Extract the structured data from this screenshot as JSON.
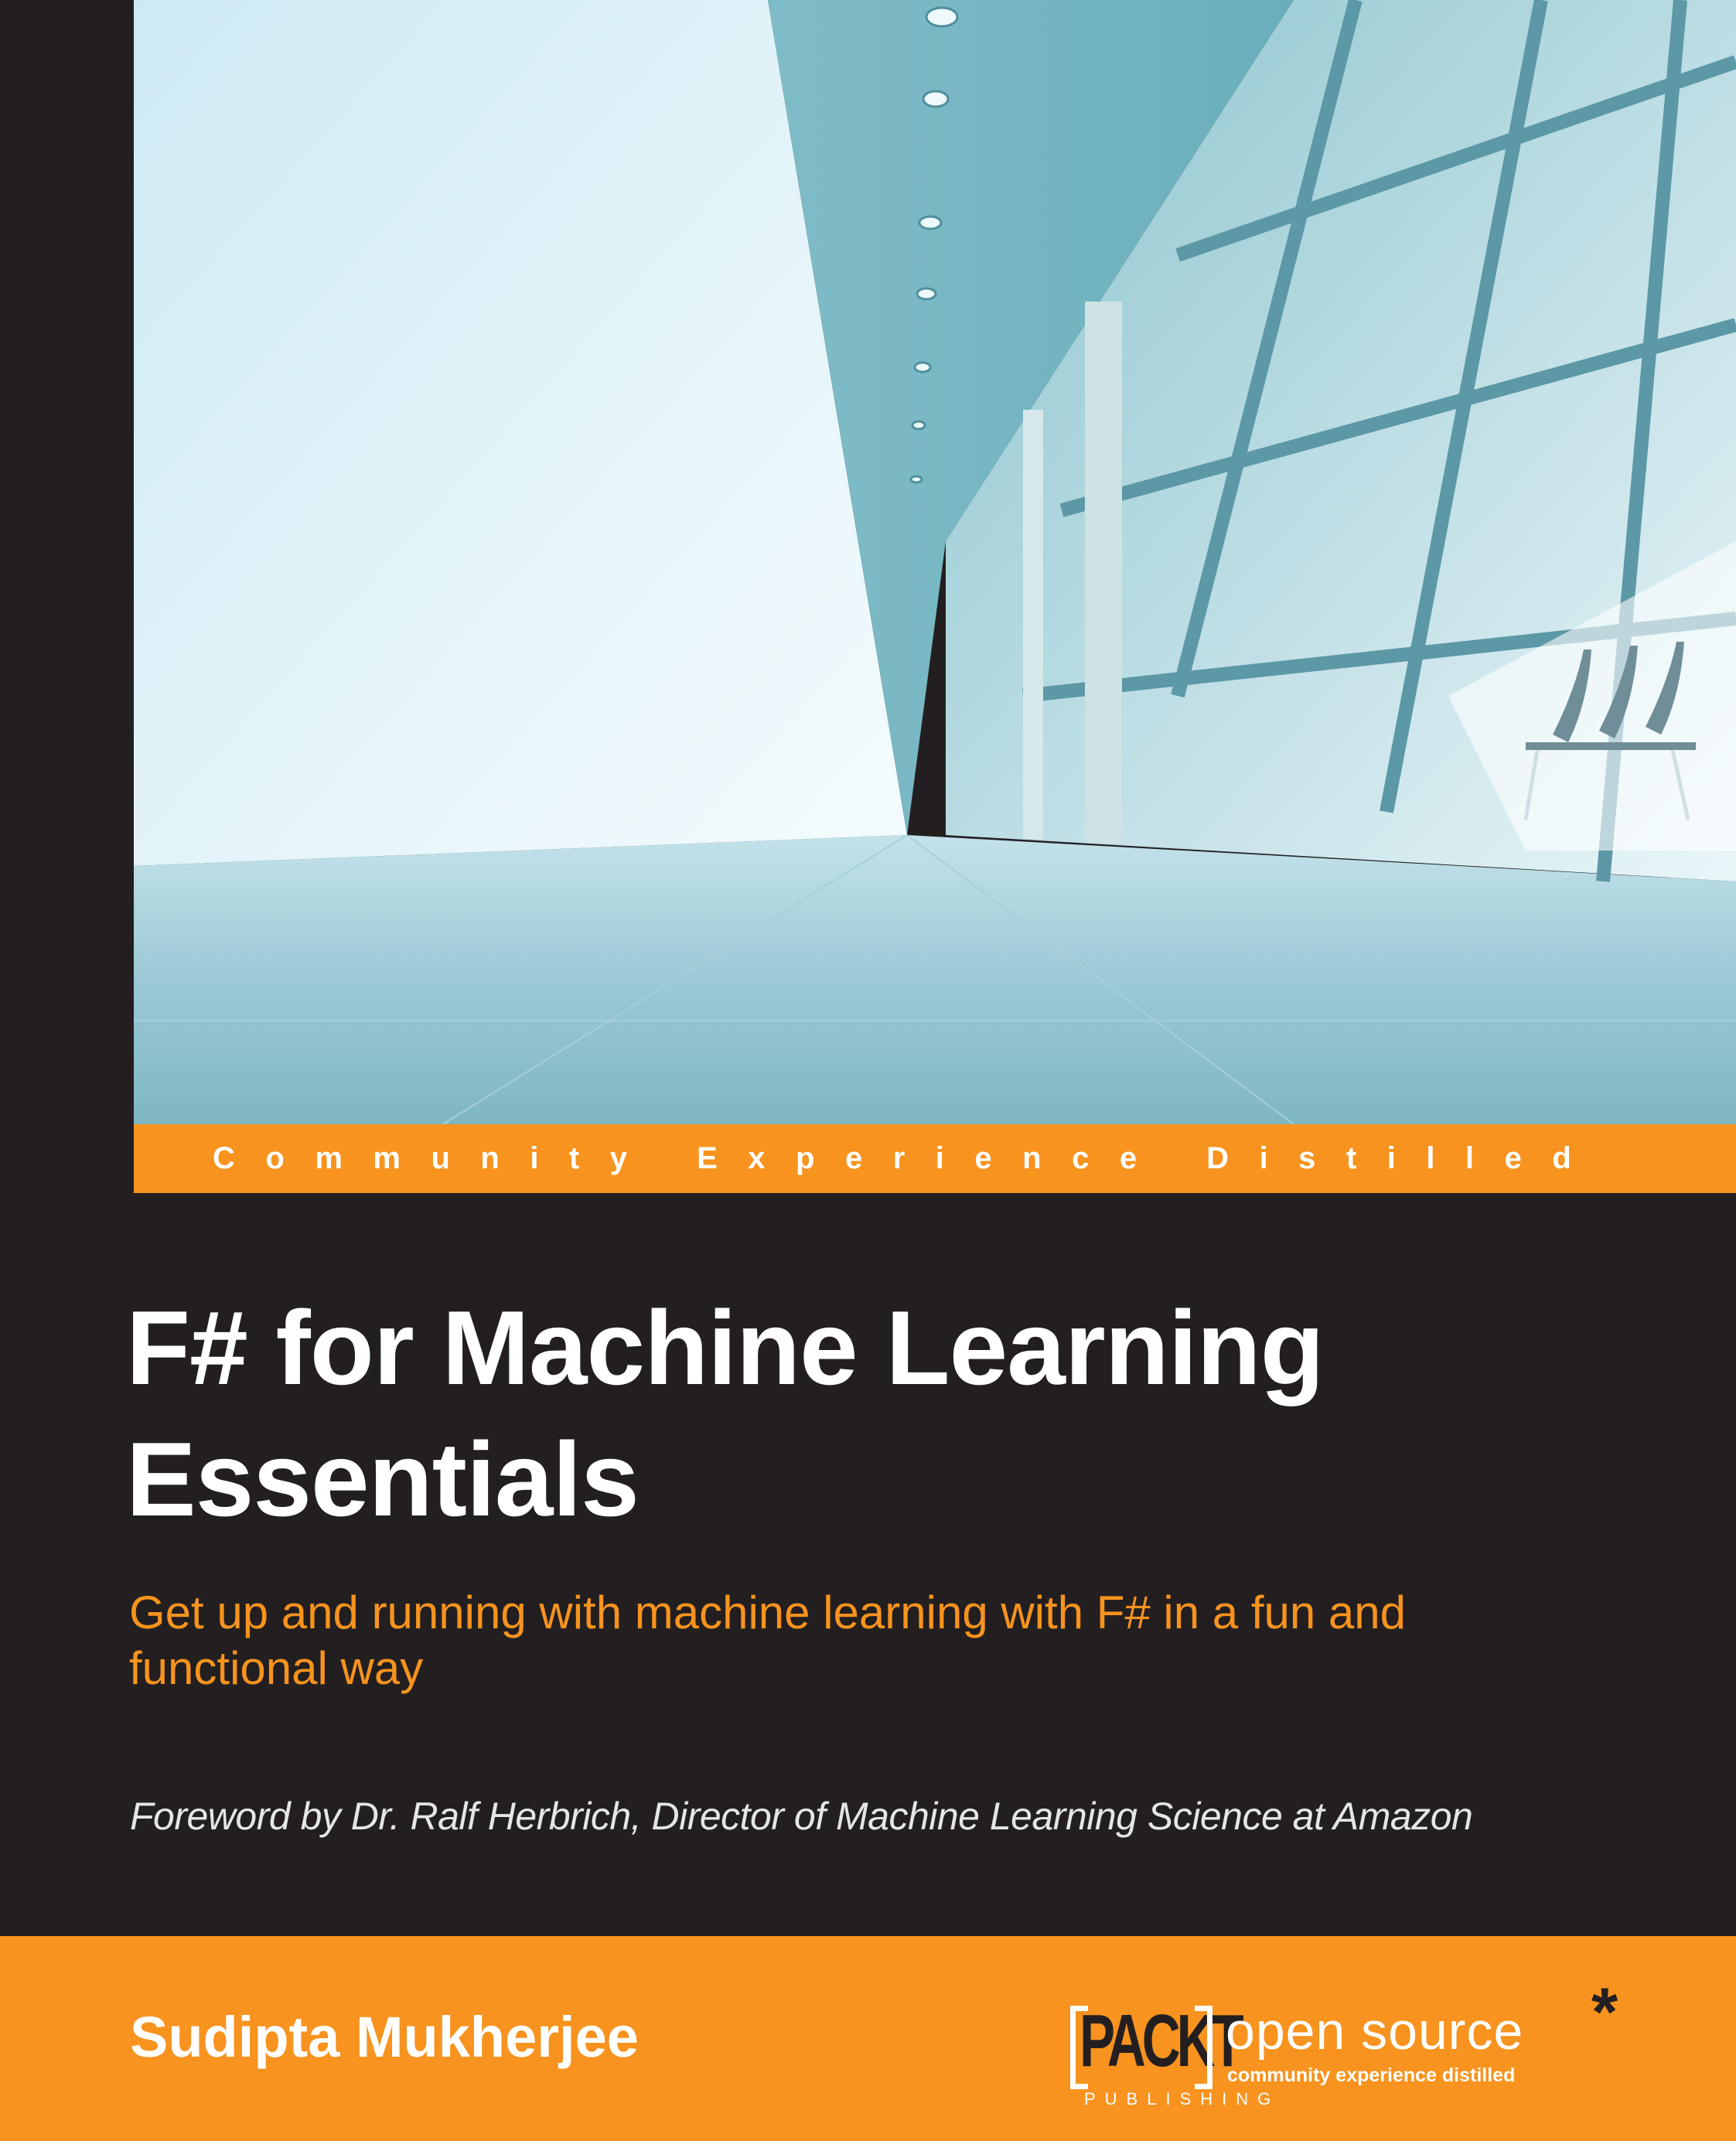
{
  "cover": {
    "tagline": "Community Experience Distilled",
    "title_lines": [
      "F# for Machine Learning",
      "Essentials"
    ],
    "subtitle_lines": [
      "Get up and running with machine learning with F# in a fun and",
      "functional way"
    ],
    "foreword": "Foreword by Dr. Ralf Herbrich, Director of Machine Learning Science at Amazon",
    "author": "Sudipta Mukherjee"
  },
  "publisher": {
    "logo_name": "PACKT",
    "logo_sub": "PUBLISHING",
    "imprint": "open source",
    "imprint_mark": "*",
    "imprint_tagline": "community experience distilled"
  },
  "image": {
    "description": "glass-corridor-photo"
  },
  "colors": {
    "accent_orange": "#f7931e",
    "background_dark": "#231f20",
    "title_white": "#ffffff",
    "foreword_gray": "#e6e6e6"
  }
}
